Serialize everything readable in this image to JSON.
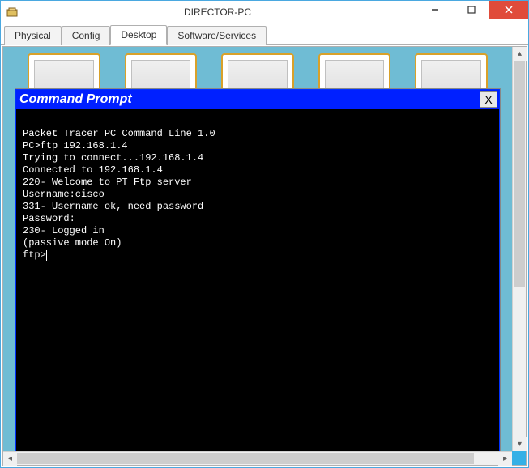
{
  "window": {
    "title": "DIRECTOR-PC"
  },
  "tabs": [
    {
      "label": "Physical",
      "active": false
    },
    {
      "label": "Config",
      "active": false
    },
    {
      "label": "Desktop",
      "active": true
    },
    {
      "label": "Software/Services",
      "active": false
    }
  ],
  "cmd": {
    "title": "Command Prompt",
    "close_label": "X",
    "lines": [
      "Packet Tracer PC Command Line 1.0",
      "PC>ftp 192.168.1.4",
      "Trying to connect...192.168.1.4",
      "Connected to 192.168.1.4",
      "220- Welcome to PT Ftp server",
      "Username:cisco",
      "331- Username ok, need password",
      "Password:",
      "230- Logged in",
      "(passive mode On)",
      "ftp>"
    ]
  }
}
